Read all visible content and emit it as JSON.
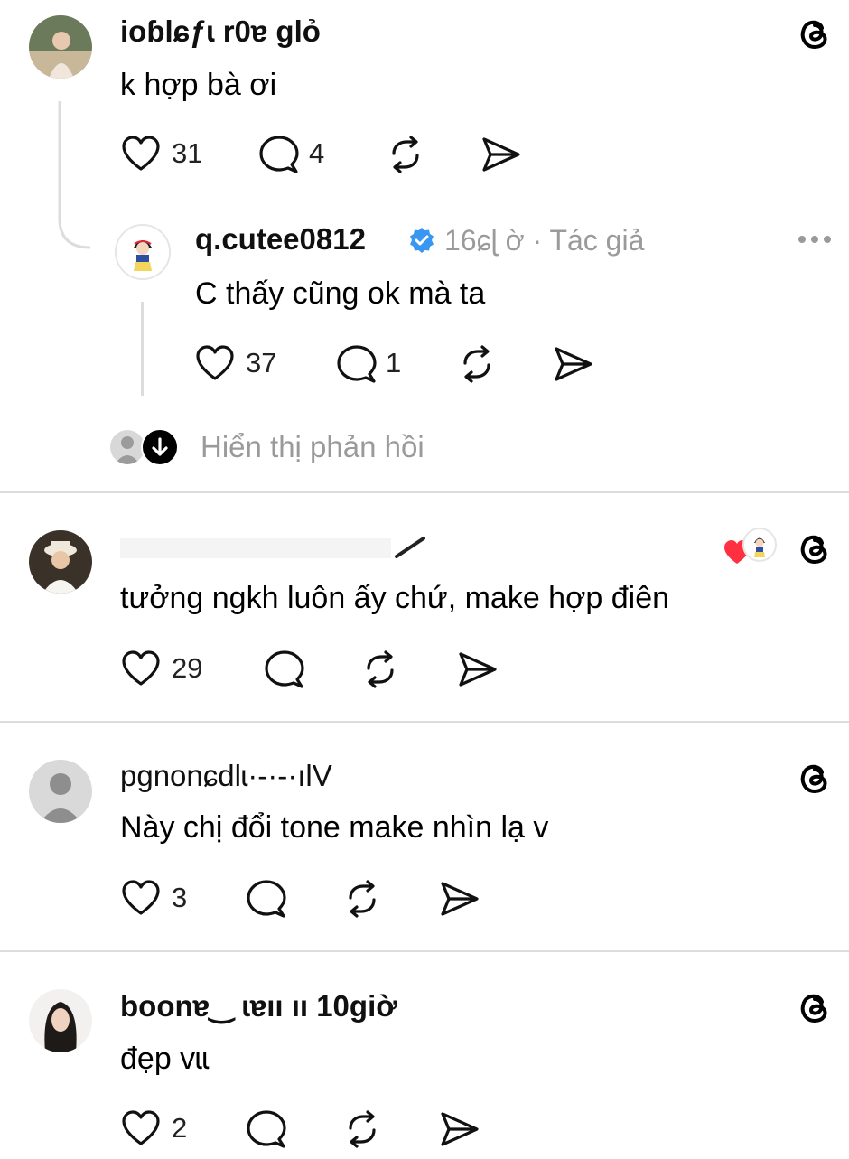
{
  "comments": [
    {
      "username": "ioɓl⁠ɕƒɩ r0ɐ ɡlỏ",
      "text": "k hợp bà ơi",
      "likes": "31",
      "replies": "4"
    },
    {
      "username": "q.cutee0812",
      "time": "16ɕɭ ờ",
      "author_tag": "· Tác giả",
      "text": "C thấy cũng ok mà ta",
      "likes": "37",
      "replies": "1",
      "show_replies": "Hiển thị phản hồi"
    },
    {
      "username": "",
      "text": "tưởng ngkh luôn ấy chứ, make hợp điên",
      "likes": "29"
    },
    {
      "username": "pgnonɕdlɩ·-·-·ılV",
      "text": "Này chị đổi tone make nhìn lạ v",
      "likes": "3"
    },
    {
      "username": "boonɐ‿ ɩɐıı ıı  10ɡiờ",
      "text": "đẹp vɩɩ",
      "likes": "2"
    }
  ],
  "icons": {
    "like": "heart-icon",
    "reply": "comment-bubble-icon",
    "repost": "repost-icon",
    "share": "send-icon",
    "threads": "threads-logo-icon",
    "more": "more-dots-icon",
    "verified": "verified-badge-icon"
  },
  "colors": {
    "verified": "#3897f0",
    "like_red": "#ff3040",
    "divider": "#dcdcdc",
    "meta": "#9a9a9a"
  }
}
